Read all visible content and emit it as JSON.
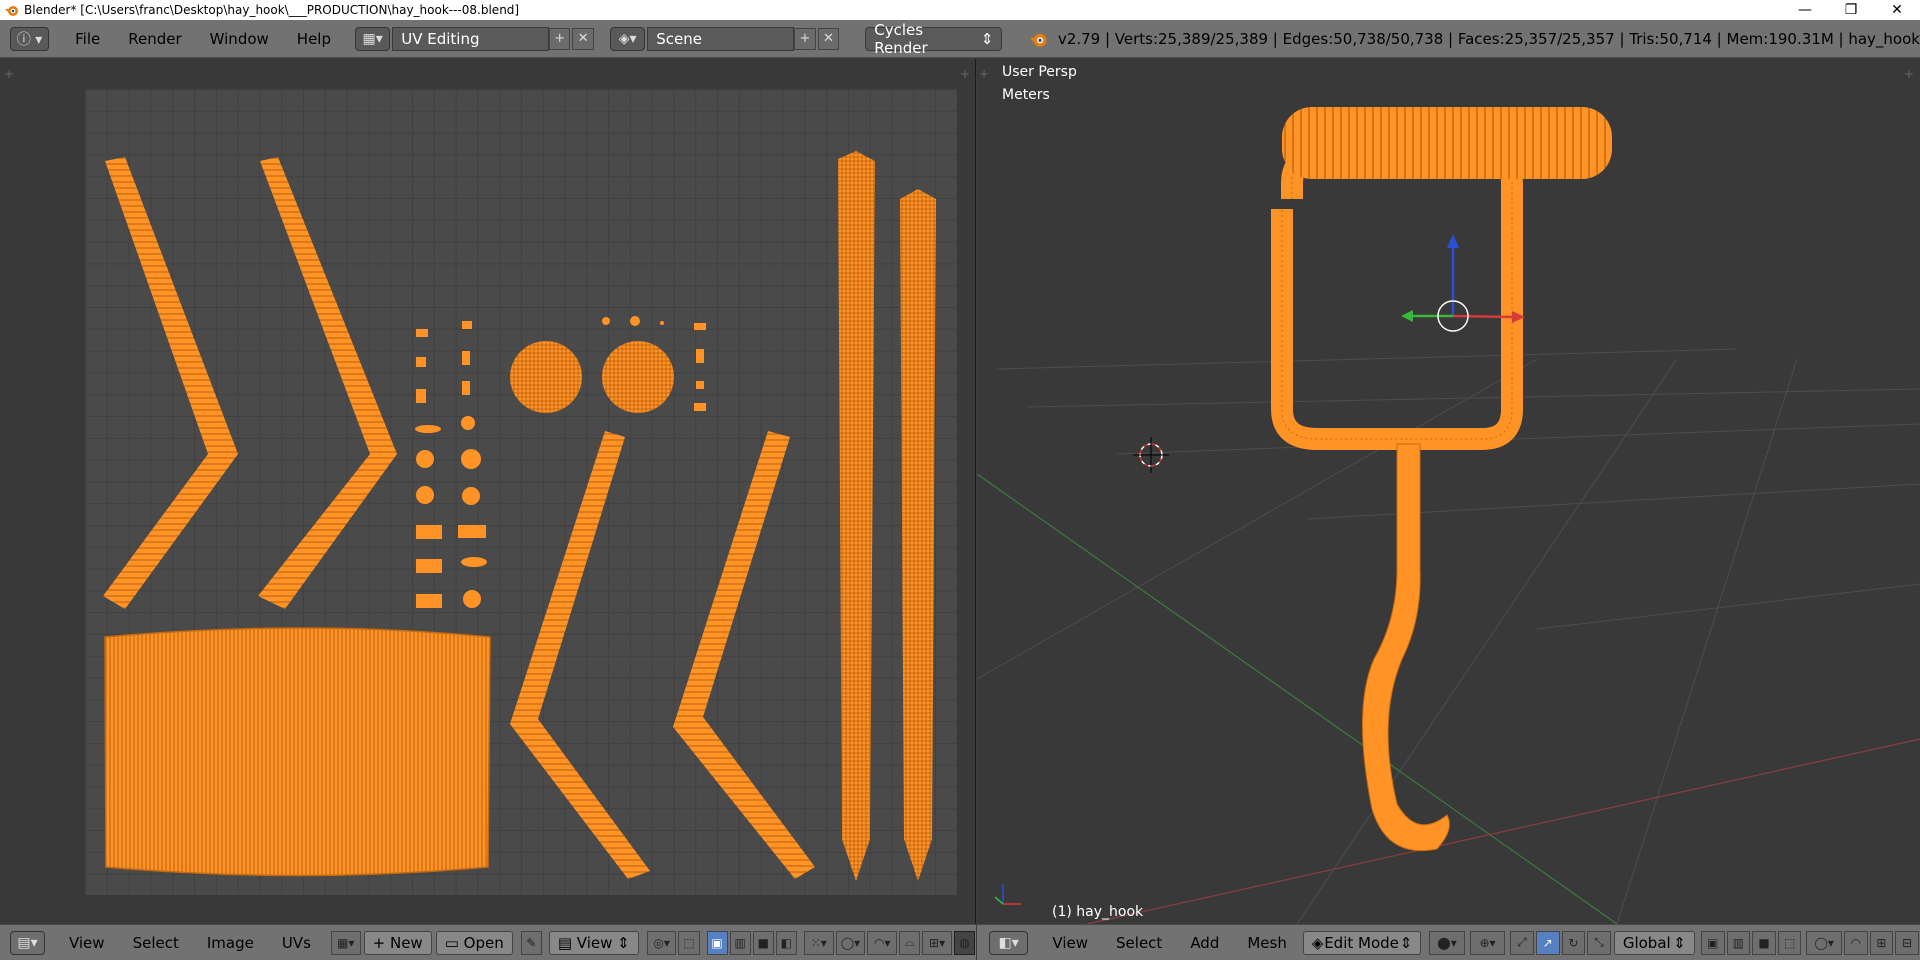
{
  "window": {
    "title": "Blender* [C:\\Users\\franc\\Desktop\\hay_hook\\___PRODUCTION\\hay_hook---08.blend]",
    "controls": [
      "—",
      "❐",
      "✕"
    ]
  },
  "infobar": {
    "menus": [
      "File",
      "Render",
      "Window",
      "Help"
    ],
    "screen_layout": "UV Editing",
    "scene": "Scene",
    "render_engine": "Cycles Render",
    "stats": "v2.79 | Verts:25,389/25,389 | Edges:50,738/50,738 | Faces:25,357/25,357 | Tris:50,714 | Mem:190.31M | hay_hook"
  },
  "viewport": {
    "view_name": "User Persp",
    "units": "Meters",
    "object_label": "(1) hay_hook"
  },
  "uv_footer": {
    "menus": [
      "View",
      "Select",
      "Image",
      "UVs"
    ],
    "new_label": "New",
    "open_label": "Open",
    "view_select": "View"
  },
  "view3d_footer": {
    "menus": [
      "View",
      "Select",
      "Add",
      "Mesh"
    ],
    "mode": "Edit Mode",
    "orientation": "Global"
  },
  "colors": {
    "accent_orange": "#ff9326",
    "selection_blue": "#5680c2"
  }
}
